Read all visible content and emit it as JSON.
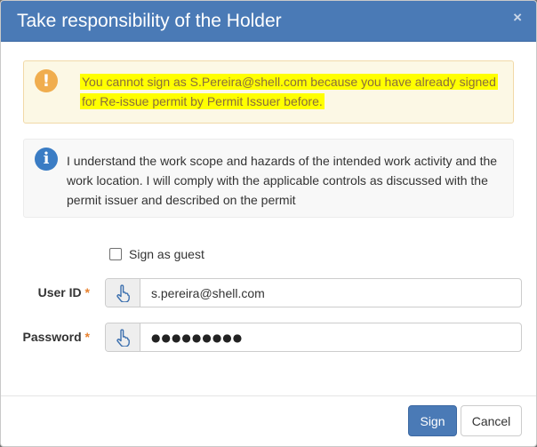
{
  "dialog": {
    "title": "Take responsibility of the Holder",
    "close_symbol": "×"
  },
  "warning": {
    "icon": "exclamation-icon",
    "line1": "You cannot sign as S.Pereira@shell.com because you have already signed",
    "line2": "for Re-issue permit by Permit Issuer before.",
    "highlight_color": "#ffff00"
  },
  "info": {
    "icon": "info-icon",
    "line1": "I understand the work scope and hazards of the intended work activity and the",
    "line2": "work location. I will comply with the applicable controls as discussed with the",
    "line3": "permit issuer and described on the permit"
  },
  "form": {
    "guest_label": "Sign as guest",
    "guest_checked": false,
    "user_id_label": "User ID",
    "user_id_value": "s.pereira@shell.com",
    "password_label": "Password",
    "password_mask": "●●●●●●●●●",
    "required_mark": "*",
    "addon_icon": "pointing-hand-icon"
  },
  "buttons": {
    "sign": "Sign",
    "cancel": "Cancel"
  },
  "colors": {
    "header": "#4a7ab6",
    "warning_icon": "#f0ad4e",
    "info_icon": "#3a7cc4",
    "required": "#e8822f"
  }
}
